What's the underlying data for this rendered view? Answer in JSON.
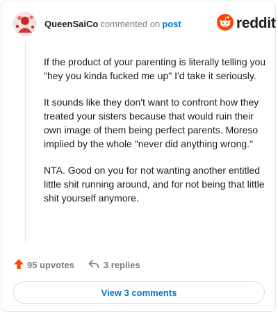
{
  "comment": {
    "username": "QueenSaiCo",
    "commented_text": "commented on",
    "post_link": "post",
    "paragraphs": [
      "If the product of your parenting is literally telling you \"hey you kinda fucked me up\" I'd take it seriously.",
      "It sounds like they don't want to confront how they treated your sisters because that would ruin their own image of them being perfect parents. Moreso implied by the whole \"never did anything wrong.\"",
      "NTA. Good on you for not wanting another entitled little shit running around, and for not being that little shit yourself anymore."
    ],
    "upvotes": "95 upvotes",
    "replies": "3 replies"
  },
  "brand": {
    "name": "reddit",
    "icon": "reddit-snoo-icon",
    "color": "#ff4500"
  },
  "footer": {
    "view_comments": "View 3 comments"
  },
  "colors": {
    "accent": "#ff4500",
    "link": "#0079d3",
    "muted": "#7c7c7c",
    "border": "#e3e5e8"
  }
}
